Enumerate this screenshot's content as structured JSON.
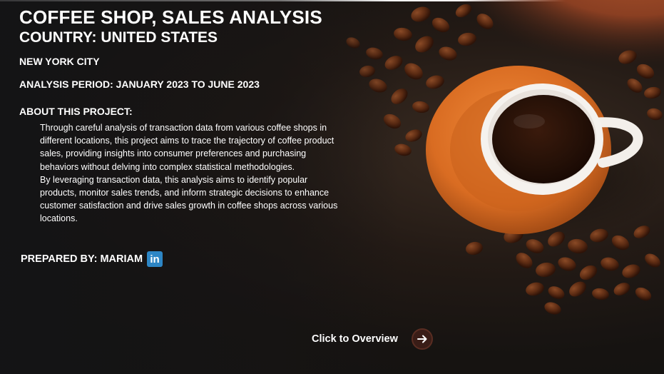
{
  "header": {
    "title": "COFFEE SHOP, SALES ANALYSIS",
    "country": "COUNTRY: UNITED STATES",
    "city": "NEW YORK CITY",
    "period": "ANALYSIS PERIOD: JANUARY 2023 TO JUNE 2023"
  },
  "about": {
    "heading": "ABOUT THIS PROJECT:",
    "paragraph1": "Through careful analysis of transaction data from various coffee shops in different locations, this project aims to trace the trajectory of coffee product sales, providing insights into consumer preferences and purchasing behaviors without delving into complex statistical methodologies.",
    "paragraph2": "By leveraging transaction data, this analysis aims to identify popular products, monitor sales trends, and inform strategic decisions to enhance customer satisfaction and drive sales growth in coffee shops across various locations."
  },
  "author": {
    "label": "PREPARED BY: MARIAM",
    "linkedin_icon_text": "in",
    "linkedin_color": "#2d86c5"
  },
  "navigation": {
    "cta_label": "Click to Overview",
    "cta_icon": "arrow-right-icon"
  },
  "colors": {
    "background": "#161311",
    "saucer": "#e07a2c",
    "cup": "#f5f2ee",
    "coffee": "#2a150c",
    "cta_button": "#3a1d17"
  }
}
